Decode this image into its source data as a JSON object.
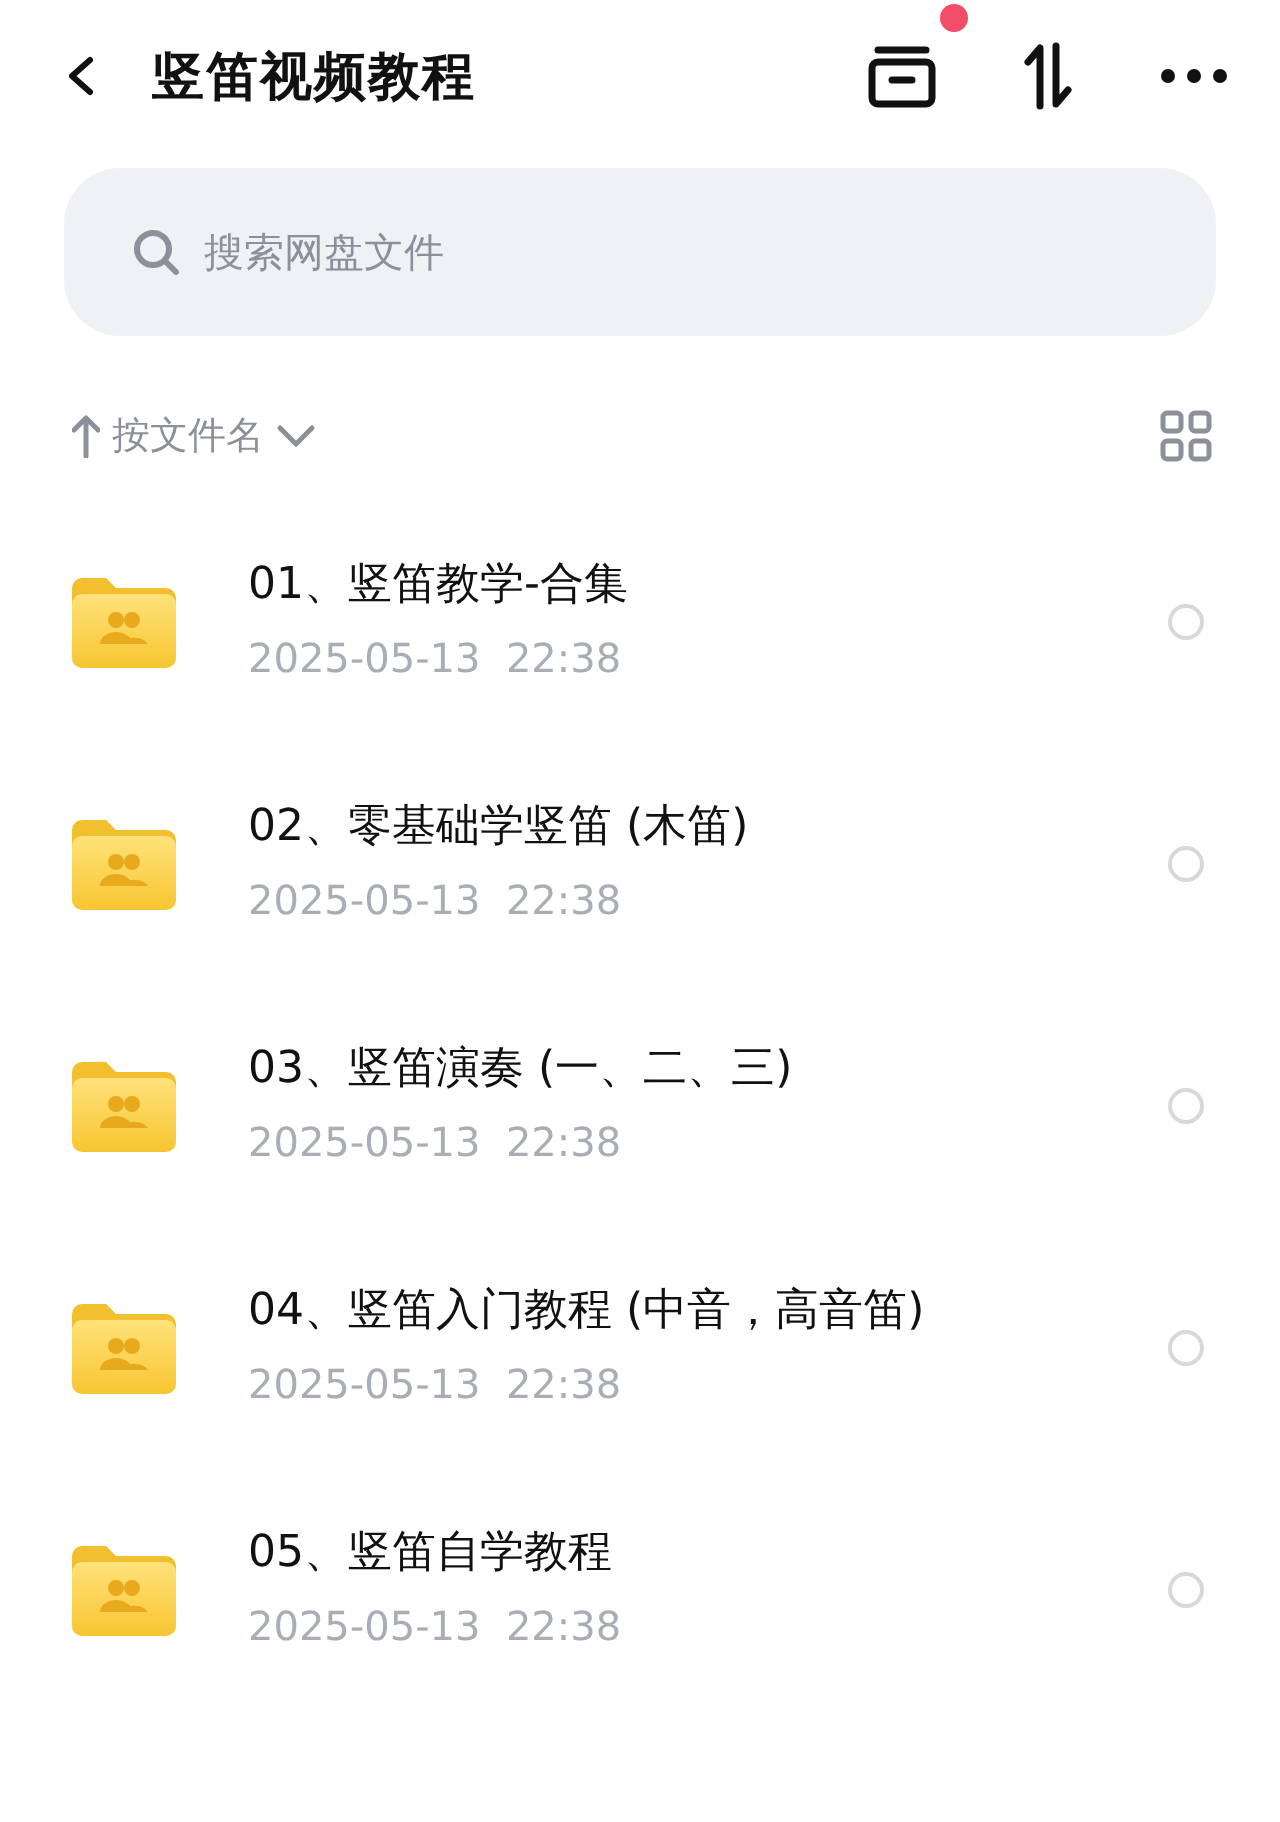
{
  "header": {
    "title": "竖笛视频教程",
    "archive_notification": true
  },
  "search": {
    "placeholder": "搜索网盘文件"
  },
  "sort": {
    "label": "按文件名"
  },
  "files": [
    {
      "name": "01、竖笛教学-合集",
      "date": "2025-05-13  22:38",
      "selected": false
    },
    {
      "name": "02、零基础学竖笛 (木笛)",
      "date": "2025-05-13  22:38",
      "selected": false
    },
    {
      "name": "03、竖笛演奏 (一、二、三)",
      "date": "2025-05-13  22:38",
      "selected": false
    },
    {
      "name": "04、竖笛入门教程 (中音，高音笛)",
      "date": "2025-05-13  22:38",
      "selected": false
    },
    {
      "name": "05、竖笛自学教程",
      "date": "2025-05-13  22:38",
      "selected": false
    }
  ]
}
